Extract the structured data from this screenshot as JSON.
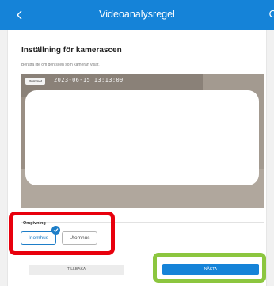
{
  "header": {
    "title": "Videoanalysregel",
    "back_icon": "chevron-left-icon",
    "cut_glyph": "C"
  },
  "page": {
    "title": "Inställning för kamerascen",
    "subtitle": "Berätta lite om den scen som kameran visar."
  },
  "camera": {
    "live_badge": "Rummet",
    "timestamp": "2023-06-15 13:13:09"
  },
  "environment": {
    "label": "Omgivning",
    "options": [
      "Inomhus",
      "Utomhus"
    ],
    "selected": "Inomhus"
  },
  "footer": {
    "back_label": "TILLBAKA",
    "next_label": "NÄSTA"
  },
  "colors": {
    "brand_blue": "#1583d8",
    "highlight_red": "#e8000d",
    "highlight_green": "#8cc63f"
  }
}
